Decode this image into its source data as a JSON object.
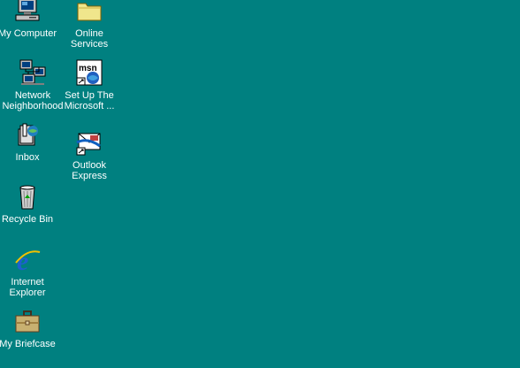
{
  "desktop": {
    "background_color": "#008080",
    "icons": [
      {
        "name": "my-computer",
        "label": "My Computer",
        "icon": "computer-icon"
      },
      {
        "name": "online-services",
        "label": "Online\nServices",
        "icon": "folder-icon"
      },
      {
        "name": "network-neighborhood",
        "label": "Network\nNeighborhood",
        "icon": "network-icon"
      },
      {
        "name": "set-up-msn",
        "label": "Set Up The\nMicrosoft ...",
        "icon": "msn-shortcut-icon"
      },
      {
        "name": "inbox",
        "label": "Inbox",
        "icon": "inbox-icon"
      },
      {
        "name": "outlook-express",
        "label": "Outlook\nExpress",
        "icon": "outlook-express-icon"
      },
      {
        "name": "recycle-bin",
        "label": "Recycle Bin",
        "icon": "recycle-bin-icon"
      },
      {
        "name": "internet-explorer",
        "label": "Internet\nExplorer",
        "icon": "internet-explorer-icon"
      },
      {
        "name": "my-briefcase",
        "label": "My Briefcase",
        "icon": "briefcase-icon"
      }
    ]
  }
}
